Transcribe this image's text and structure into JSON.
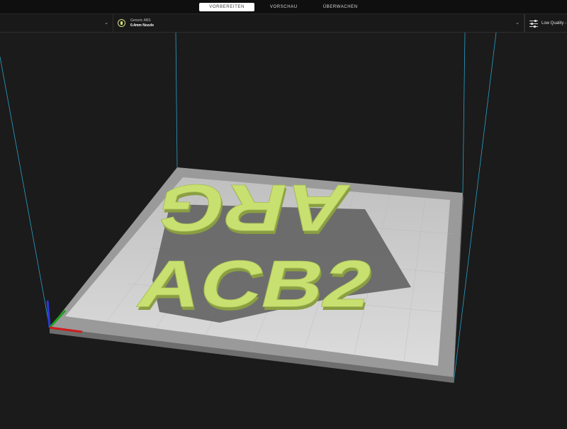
{
  "stages": [
    {
      "label": "VORBEREITEN",
      "active": true
    },
    {
      "label": "VORSCHAU",
      "active": false
    },
    {
      "label": "ÜBERWACHEN",
      "active": false
    }
  ],
  "material": {
    "name": "Generic ABS",
    "nozzle": "0.4mm Nozzle"
  },
  "quality": {
    "label": "Low Quality -"
  },
  "model": {
    "text_row1": "ARG",
    "text_row2": "ACB2",
    "color": "#c8e070",
    "shadow_color": "#8a9e42"
  },
  "colors": {
    "background": "#1b1b1b",
    "bed": "#c8c8c8",
    "build_volume_edge": "#2aa0c8",
    "axis_x": "#d01c1c",
    "axis_y": "#1ca01c",
    "axis_z": "#2a3ad8"
  }
}
